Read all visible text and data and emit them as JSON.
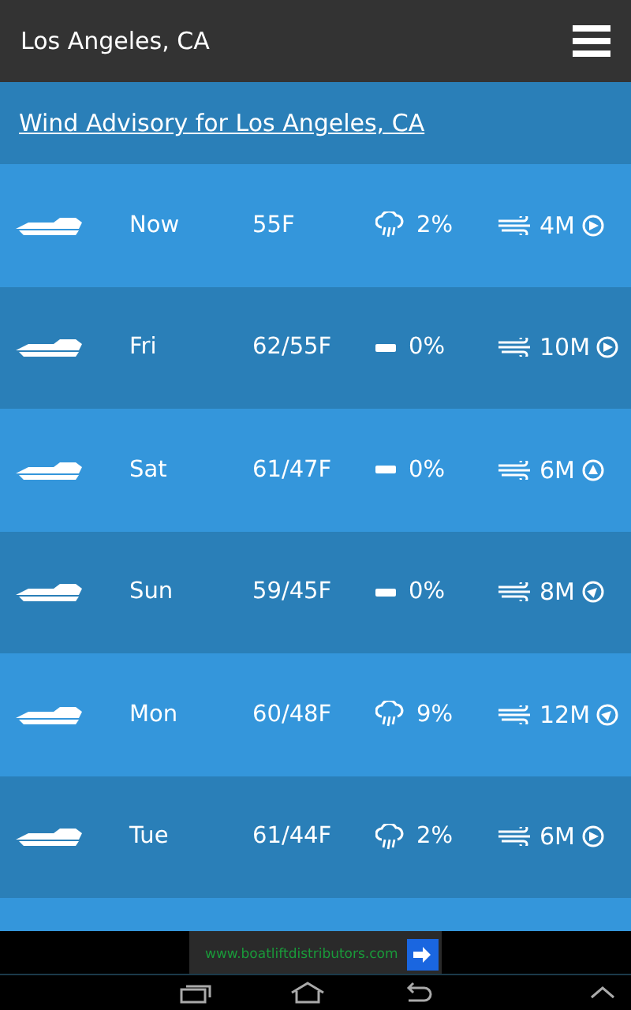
{
  "header": {
    "title": "Los Angeles, CA"
  },
  "advisory": {
    "text": "Wind Advisory for Los Angeles, CA"
  },
  "forecast": [
    {
      "day": "Now",
      "temp": "55F",
      "precip": {
        "kind": "rain",
        "chance": "2%"
      },
      "wind": {
        "speed": "4M",
        "arrow": {
          "kind": "east"
        }
      }
    },
    {
      "day": "Fri",
      "temp": "62/55F",
      "precip": {
        "kind": "none",
        "chance": "0%"
      },
      "wind": {
        "speed": "10M",
        "arrow": {
          "kind": "east"
        }
      }
    },
    {
      "day": "Sat",
      "temp": "61/47F",
      "precip": {
        "kind": "none",
        "chance": "0%"
      },
      "wind": {
        "speed": "6M",
        "arrow": {
          "kind": "north"
        }
      }
    },
    {
      "day": "Sun",
      "temp": "59/45F",
      "precip": {
        "kind": "none",
        "chance": "0%"
      },
      "wind": {
        "speed": "8M",
        "arrow": {
          "kind": "northeast"
        }
      }
    },
    {
      "day": "Mon",
      "temp": "60/48F",
      "precip": {
        "kind": "rain",
        "chance": "9%"
      },
      "wind": {
        "speed": "12M",
        "arrow": {
          "kind": "northeast"
        }
      }
    },
    {
      "day": "Tue",
      "temp": "61/44F",
      "precip": {
        "kind": "rain",
        "chance": "2%"
      },
      "wind": {
        "speed": "6M",
        "arrow": {
          "kind": "east"
        }
      }
    }
  ],
  "ad": {
    "url": "www.boatliftdistributors.com"
  }
}
